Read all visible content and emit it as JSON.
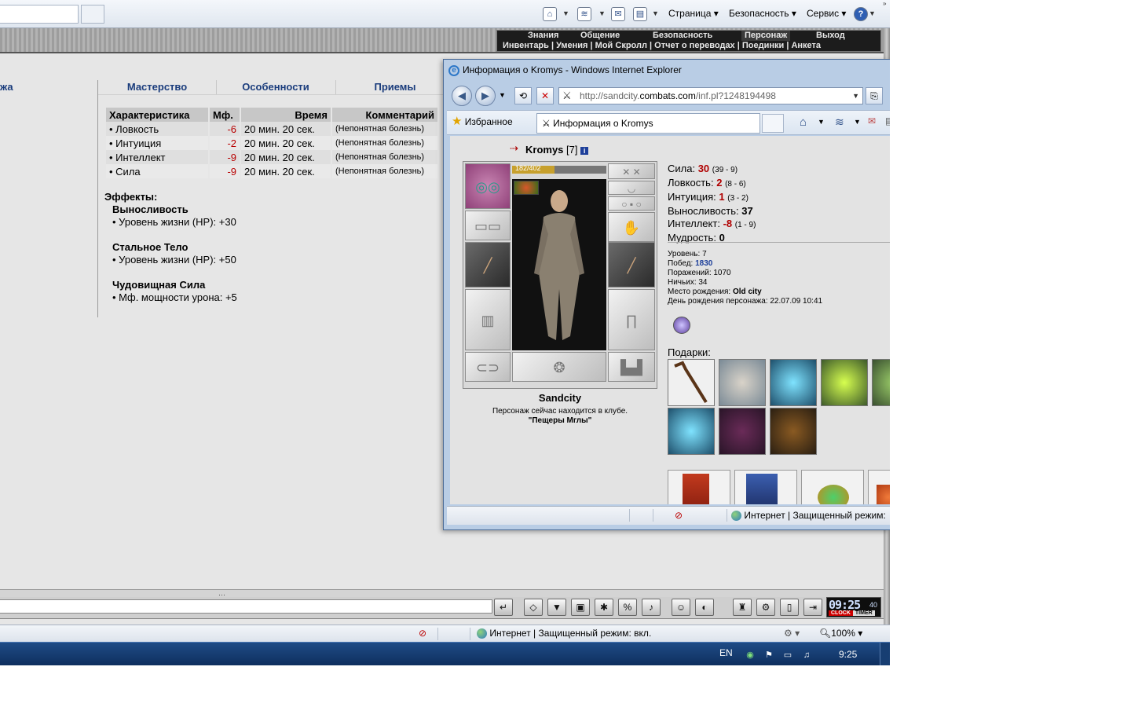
{
  "ie_toolbar": {
    "menu_page": "Страница",
    "menu_safety": "Безопасность",
    "menu_tools": "Сервис",
    "help": "?"
  },
  "game_menu": {
    "top": [
      "Знания",
      "Общение",
      "Безопасность",
      "Персонаж",
      "Выход"
    ],
    "active": "Персонаж",
    "sub": "Инвентарь | Умения | Мой Скролл | Отчет о переводах | Поединки | Анкета"
  },
  "content": {
    "left_clip": "жа",
    "tabs": [
      "Мастерство",
      "Особенности",
      "Приемы"
    ],
    "table": {
      "headers": [
        "Характеристика",
        "Мф.",
        "Время",
        "Комментарий"
      ],
      "rows": [
        {
          "stat": "• Ловкость",
          "mf": "-6",
          "time": "20 мин. 20 сек.",
          "comment": "(Непонятная болезнь)"
        },
        {
          "stat": "• Интуиция",
          "mf": "-2",
          "time": "20 мин. 20 сек.",
          "comment": "(Непонятная болезнь)"
        },
        {
          "stat": "• Интеллект",
          "mf": "-9",
          "time": "20 мин. 20 сек.",
          "comment": "(Непонятная болезнь)"
        },
        {
          "stat": "• Сила",
          "mf": "-9",
          "time": "20 мин. 20 сек.",
          "comment": "(Непонятная болезнь)"
        }
      ]
    },
    "effects_title": "Эффекты:",
    "effects": [
      {
        "name": "Выносливость",
        "item": "• Уровень жизни (HP): +30"
      },
      {
        "name": "Стальное Тело",
        "item": "• Уровень жизни (HP): +50"
      },
      {
        "name": "Чудовищная Сила",
        "item": "• Мф. мощности урона: +5"
      }
    ]
  },
  "clock": {
    "time": "09:25",
    "seconds": "40",
    "label_clock": "CLOCK",
    "label_timer": "TIMER"
  },
  "status_bar": {
    "zone": "Интернет | Защищенный режим: вкл.",
    "zoom": "100%"
  },
  "taskbar": {
    "lang": "EN",
    "time": "9:25"
  },
  "popup": {
    "title": "Информация о Kromys - Windows Internet Explorer",
    "url_prefix": "http://sandcity.",
    "url_domain": "combats.com",
    "url_path": "/inf.pl?1248194498",
    "favorites": "Избранное",
    "tab_title": "Информация о Kromys",
    "status_zone": "Интернет | Защищенный режим:",
    "character": {
      "name": "Kromys",
      "level": "[7]",
      "hp_text": "182/402",
      "hp_fraction": 0.4527,
      "city": "Sandcity",
      "club_line": "Персонаж сейчас находится в клубе.",
      "club_name": "\"Пещеры Мглы\""
    },
    "stats": [
      {
        "label": "Сила:",
        "value": "30",
        "red": true,
        "range": "(39 - 9)"
      },
      {
        "label": "Ловкость:",
        "value": "2",
        "red": true,
        "range": "(8 - 6)"
      },
      {
        "label": "Интуиция:",
        "value": "1",
        "red": true,
        "range": "(3 - 2)"
      },
      {
        "label": "Выносливость:",
        "value": "37",
        "red": false,
        "range": ""
      },
      {
        "label": "Интеллект:",
        "value": "-8",
        "red": true,
        "range": "(1 - 9)"
      },
      {
        "label": "Мудрость:",
        "value": "0",
        "red": false,
        "range": ""
      }
    ],
    "info": {
      "level": "Уровень: 7",
      "wins_label": "Побед:",
      "wins": "1830",
      "losses": "Поражений: 1070",
      "draws": "Ничьих: 34",
      "birthplace_label": "Место рождения:",
      "birthplace": "Old city",
      "birthday": "День рождения персонажа: 22.07.09 10:41"
    },
    "gifts_label": "Подарки:"
  }
}
